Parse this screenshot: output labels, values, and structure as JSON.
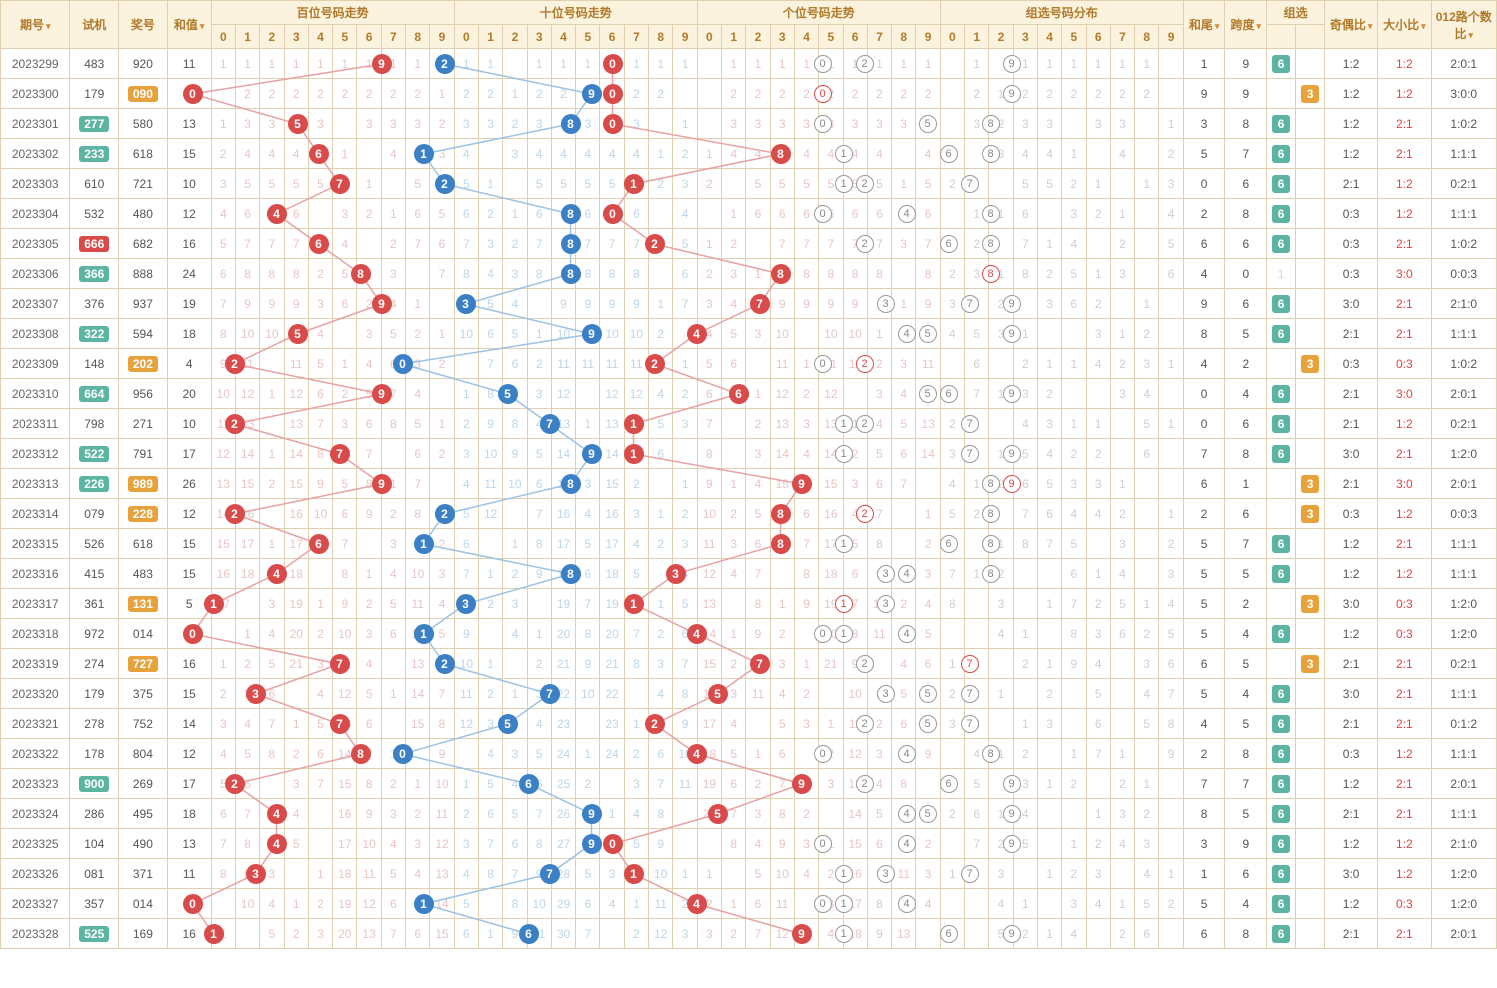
{
  "headers": {
    "issue": "期号",
    "test": "试机",
    "draw": "奖号",
    "sum": "和值",
    "hundreds": "百位号码走势",
    "tens": "十位号码走势",
    "ones": "个位号码走势",
    "combo": "组选号码分布",
    "tail": "和尾",
    "span": "跨度",
    "group": "组选",
    "odd": "奇偶比",
    "big": "大小比",
    "route": "012路个数比",
    "digits": [
      "0",
      "1",
      "2",
      "3",
      "4",
      "5",
      "6",
      "7",
      "8",
      "9"
    ]
  },
  "chart_data": {
    "type": "table",
    "title": "3D 号码走势",
    "columns": [
      "期号",
      "试机",
      "奖号",
      "和值",
      "百位",
      "十位",
      "个位",
      "和尾",
      "跨度",
      "组选",
      "奇偶比",
      "大小比",
      "012路个数比"
    ],
    "rows": [
      {
        "issue": "2023299",
        "test": "483",
        "test_hl": false,
        "draw": "920",
        "draw_hl": false,
        "sum": 11,
        "h": 9,
        "t": 2,
        "o": 0,
        "tail": 1,
        "span": 9,
        "group": 6,
        "odd": "1:2",
        "odd_red": false,
        "big": "1:2",
        "big_red": true,
        "route": "2:0:1"
      },
      {
        "issue": "2023300",
        "test": "179",
        "test_hl": false,
        "draw": "090",
        "draw_hl": true,
        "sum": 9,
        "h": 0,
        "t": 9,
        "o": 0,
        "tail": 9,
        "span": 9,
        "group": 3,
        "odd": "1:2",
        "odd_red": false,
        "big": "1:2",
        "big_red": true,
        "route": "3:0:0"
      },
      {
        "issue": "2023301",
        "test": "277",
        "test_hl": true,
        "draw": "580",
        "draw_hl": false,
        "sum": 13,
        "h": 5,
        "t": 8,
        "o": 0,
        "tail": 3,
        "span": 8,
        "group": 6,
        "odd": "1:2",
        "odd_red": false,
        "big": "2:1",
        "big_red": true,
        "route": "1:0:2"
      },
      {
        "issue": "2023302",
        "test": "233",
        "test_hl": true,
        "draw": "618",
        "draw_hl": false,
        "sum": 15,
        "h": 6,
        "t": 1,
        "o": 8,
        "tail": 5,
        "span": 7,
        "group": 6,
        "odd": "1:2",
        "odd_red": false,
        "big": "2:1",
        "big_red": true,
        "route": "1:1:1"
      },
      {
        "issue": "2023303",
        "test": "610",
        "test_hl": false,
        "draw": "721",
        "draw_hl": false,
        "sum": 10,
        "h": 7,
        "t": 2,
        "o": 1,
        "tail": 0,
        "span": 6,
        "group": 6,
        "odd": "2:1",
        "odd_red": false,
        "big": "1:2",
        "big_red": true,
        "route": "0:2:1"
      },
      {
        "issue": "2023304",
        "test": "532",
        "test_hl": false,
        "draw": "480",
        "draw_hl": false,
        "sum": 12,
        "h": 4,
        "t": 8,
        "o": 0,
        "tail": 2,
        "span": 8,
        "group": 6,
        "odd": "0:3",
        "odd_red": false,
        "big": "1:2",
        "big_red": true,
        "route": "1:1:1"
      },
      {
        "issue": "2023305",
        "test": "666",
        "test_hl": "red",
        "draw": "682",
        "draw_hl": false,
        "sum": 16,
        "h": 6,
        "t": 8,
        "o": 2,
        "tail": 6,
        "span": 6,
        "group": 6,
        "odd": "0:3",
        "odd_red": false,
        "big": "2:1",
        "big_red": true,
        "route": "1:0:2"
      },
      {
        "issue": "2023306",
        "test": "366",
        "test_hl": true,
        "draw": "888",
        "draw_hl": false,
        "sum": 24,
        "h": 8,
        "t": 8,
        "o": 8,
        "tail": 4,
        "span": 0,
        "group": 1,
        "odd": "0:3",
        "odd_red": false,
        "big": "3:0",
        "big_red": true,
        "route": "0:0:3"
      },
      {
        "issue": "2023307",
        "test": "376",
        "test_hl": false,
        "draw": "937",
        "draw_hl": false,
        "sum": 19,
        "h": 9,
        "t": 3,
        "o": 7,
        "tail": 9,
        "span": 6,
        "group": 6,
        "odd": "3:0",
        "odd_red": false,
        "big": "2:1",
        "big_red": true,
        "route": "2:1:0"
      },
      {
        "issue": "2023308",
        "test": "322",
        "test_hl": true,
        "draw": "594",
        "draw_hl": false,
        "sum": 18,
        "h": 5,
        "t": 9,
        "o": 4,
        "tail": 8,
        "span": 5,
        "group": 6,
        "odd": "2:1",
        "odd_red": false,
        "big": "2:1",
        "big_red": true,
        "route": "1:1:1"
      },
      {
        "issue": "2023309",
        "test": "148",
        "test_hl": false,
        "draw": "202",
        "draw_hl": true,
        "sum": 4,
        "h": 2,
        "t": 0,
        "o": 2,
        "tail": 4,
        "span": 2,
        "group": 3,
        "odd": "0:3",
        "odd_red": false,
        "big": "0:3",
        "big_red": true,
        "route": "1:0:2"
      },
      {
        "issue": "2023310",
        "test": "664",
        "test_hl": true,
        "draw": "956",
        "draw_hl": false,
        "sum": 20,
        "h": 9,
        "t": 5,
        "o": 6,
        "tail": 0,
        "span": 4,
        "group": 6,
        "odd": "2:1",
        "odd_red": false,
        "big": "3:0",
        "big_red": true,
        "route": "2:0:1"
      },
      {
        "issue": "2023311",
        "test": "798",
        "test_hl": false,
        "draw": "271",
        "draw_hl": false,
        "sum": 10,
        "h": 2,
        "t": 7,
        "o": 1,
        "tail": 0,
        "span": 6,
        "group": 6,
        "odd": "2:1",
        "odd_red": false,
        "big": "1:2",
        "big_red": true,
        "route": "0:2:1"
      },
      {
        "issue": "2023312",
        "test": "522",
        "test_hl": true,
        "draw": "791",
        "draw_hl": false,
        "sum": 17,
        "h": 7,
        "t": 9,
        "o": 1,
        "tail": 7,
        "span": 8,
        "group": 6,
        "odd": "3:0",
        "odd_red": false,
        "big": "2:1",
        "big_red": true,
        "route": "1:2:0"
      },
      {
        "issue": "2023313",
        "test": "226",
        "test_hl": true,
        "draw": "989",
        "draw_hl": true,
        "sum": 26,
        "h": 9,
        "t": 8,
        "o": 9,
        "tail": 6,
        "span": 1,
        "group": 3,
        "odd": "2:1",
        "odd_red": false,
        "big": "3:0",
        "big_red": true,
        "route": "2:0:1"
      },
      {
        "issue": "2023314",
        "test": "079",
        "test_hl": false,
        "draw": "228",
        "draw_hl": true,
        "sum": 12,
        "h": 2,
        "t": 2,
        "o": 8,
        "tail": 2,
        "span": 6,
        "group": 3,
        "odd": "0:3",
        "odd_red": false,
        "big": "1:2",
        "big_red": true,
        "route": "0:0:3"
      },
      {
        "issue": "2023315",
        "test": "526",
        "test_hl": false,
        "draw": "618",
        "draw_hl": false,
        "sum": 15,
        "h": 6,
        "t": 1,
        "o": 8,
        "tail": 5,
        "span": 7,
        "group": 6,
        "odd": "1:2",
        "odd_red": false,
        "big": "2:1",
        "big_red": true,
        "route": "1:1:1"
      },
      {
        "issue": "2023316",
        "test": "415",
        "test_hl": false,
        "draw": "483",
        "draw_hl": false,
        "sum": 15,
        "h": 4,
        "t": 8,
        "o": 3,
        "tail": 5,
        "span": 5,
        "group": 6,
        "odd": "1:2",
        "odd_red": false,
        "big": "1:2",
        "big_red": true,
        "route": "1:1:1"
      },
      {
        "issue": "2023317",
        "test": "361",
        "test_hl": false,
        "draw": "131",
        "draw_hl": true,
        "sum": 5,
        "h": 1,
        "t": 3,
        "o": 1,
        "tail": 5,
        "span": 2,
        "group": 3,
        "odd": "3:0",
        "odd_red": false,
        "big": "0:3",
        "big_red": true,
        "route": "1:2:0"
      },
      {
        "issue": "2023318",
        "test": "972",
        "test_hl": false,
        "draw": "014",
        "draw_hl": false,
        "sum": 5,
        "h": 0,
        "t": 1,
        "o": 4,
        "tail": 5,
        "span": 4,
        "group": 6,
        "odd": "1:2",
        "odd_red": false,
        "big": "0:3",
        "big_red": true,
        "route": "1:2:0"
      },
      {
        "issue": "2023319",
        "test": "274",
        "test_hl": false,
        "draw": "727",
        "draw_hl": true,
        "sum": 16,
        "h": 7,
        "t": 2,
        "o": 7,
        "tail": 6,
        "span": 5,
        "group": 3,
        "odd": "2:1",
        "odd_red": false,
        "big": "2:1",
        "big_red": true,
        "route": "0:2:1"
      },
      {
        "issue": "2023320",
        "test": "179",
        "test_hl": false,
        "draw": "375",
        "draw_hl": false,
        "sum": 15,
        "h": 3,
        "t": 7,
        "o": 5,
        "tail": 5,
        "span": 4,
        "group": 6,
        "odd": "3:0",
        "odd_red": false,
        "big": "2:1",
        "big_red": true,
        "route": "1:1:1"
      },
      {
        "issue": "2023321",
        "test": "278",
        "test_hl": false,
        "draw": "752",
        "draw_hl": false,
        "sum": 14,
        "h": 7,
        "t": 5,
        "o": 2,
        "tail": 4,
        "span": 5,
        "group": 6,
        "odd": "2:1",
        "odd_red": false,
        "big": "2:1",
        "big_red": true,
        "route": "0:1:2"
      },
      {
        "issue": "2023322",
        "test": "178",
        "test_hl": false,
        "draw": "804",
        "draw_hl": false,
        "sum": 12,
        "h": 8,
        "t": 0,
        "o": 4,
        "tail": 2,
        "span": 8,
        "group": 6,
        "odd": "0:3",
        "odd_red": false,
        "big": "1:2",
        "big_red": true,
        "route": "1:1:1"
      },
      {
        "issue": "2023323",
        "test": "900",
        "test_hl": true,
        "draw": "269",
        "draw_hl": false,
        "sum": 17,
        "h": 2,
        "t": 6,
        "o": 9,
        "tail": 7,
        "span": 7,
        "group": 6,
        "odd": "1:2",
        "odd_red": false,
        "big": "2:1",
        "big_red": true,
        "route": "2:0:1"
      },
      {
        "issue": "2023324",
        "test": "286",
        "test_hl": false,
        "draw": "495",
        "draw_hl": false,
        "sum": 18,
        "h": 4,
        "t": 9,
        "o": 5,
        "tail": 8,
        "span": 5,
        "group": 6,
        "odd": "2:1",
        "odd_red": false,
        "big": "2:1",
        "big_red": true,
        "route": "1:1:1"
      },
      {
        "issue": "2023325",
        "test": "104",
        "test_hl": false,
        "draw": "490",
        "draw_hl": false,
        "sum": 13,
        "h": 4,
        "t": 9,
        "o": 0,
        "tail": 3,
        "span": 9,
        "group": 6,
        "odd": "1:2",
        "odd_red": false,
        "big": "1:2",
        "big_red": true,
        "route": "2:1:0"
      },
      {
        "issue": "2023326",
        "test": "081",
        "test_hl": false,
        "draw": "371",
        "draw_hl": false,
        "sum": 11,
        "h": 3,
        "t": 7,
        "o": 1,
        "tail": 1,
        "span": 6,
        "group": 6,
        "odd": "3:0",
        "odd_red": false,
        "big": "1:2",
        "big_red": true,
        "route": "1:2:0"
      },
      {
        "issue": "2023327",
        "test": "357",
        "test_hl": false,
        "draw": "014",
        "draw_hl": false,
        "sum": 5,
        "h": 0,
        "t": 1,
        "o": 4,
        "tail": 5,
        "span": 4,
        "group": 6,
        "odd": "1:2",
        "odd_red": false,
        "big": "0:3",
        "big_red": true,
        "route": "1:2:0"
      },
      {
        "issue": "2023328",
        "test": "525",
        "test_hl": true,
        "draw": "169",
        "draw_hl": false,
        "sum": 16,
        "h": 1,
        "t": 6,
        "o": 9,
        "tail": 6,
        "span": 8,
        "group": 6,
        "odd": "2:1",
        "odd_red": false,
        "big": "2:1",
        "big_red": true,
        "route": "2:0:1"
      }
    ]
  },
  "group_labels": {
    "6": "6",
    "3": "3",
    "1": "1"
  }
}
